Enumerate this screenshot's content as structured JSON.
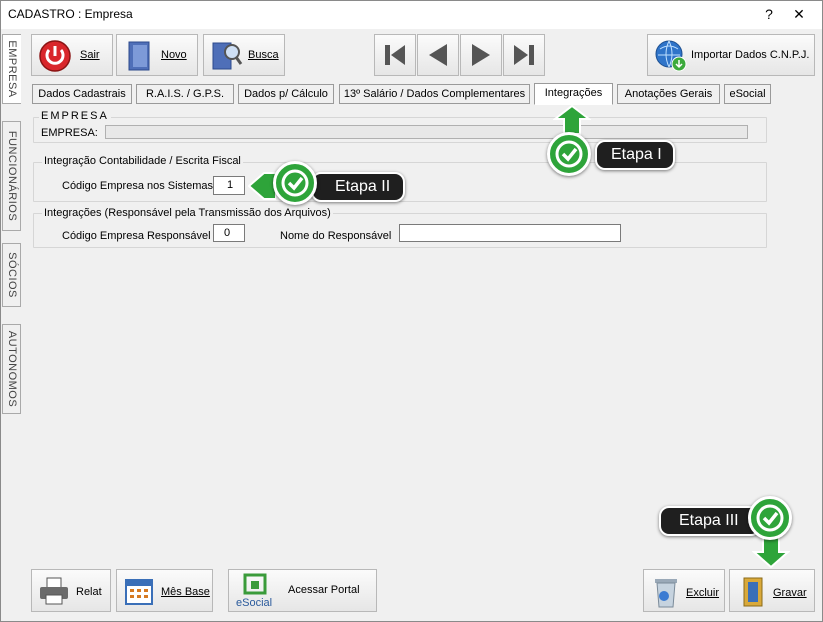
{
  "window": {
    "title": "CADASTRO : Empresa",
    "help": "?",
    "close": "✕"
  },
  "side_tabs": [
    "EMPRESA",
    "FUNCIONÁRIOS",
    "SÓCIOS",
    "AUTONOMOS"
  ],
  "toolbar": {
    "sair": "Sair",
    "novo": "Novo",
    "busca": "Busca",
    "importar": "Importar Dados C.N.P.J."
  },
  "tabs": [
    "Dados Cadastrais",
    "R.A.I.S. / G.P.S.",
    "Dados p/ Cálculo",
    "13º Salário / Dados Complementares",
    "Integrações",
    "Anotações Gerais",
    "eSocial"
  ],
  "empresa_group": {
    "title": "EMPRESA",
    "label": "EMPRESA:",
    "value": ""
  },
  "contab_group": {
    "title": "Integração Contabilidade / Escrita Fiscal",
    "codigo_label": "Código Empresa nos Sistemas",
    "codigo_value": "1"
  },
  "resp_group": {
    "title": "Integrações (Responsável pela Transmissão dos Arquivos)",
    "codigo_label": "Código Empresa Responsável",
    "codigo_value": "0",
    "nome_label": "Nome do Responsável",
    "nome_value": ""
  },
  "bottom": {
    "relat": "Relat",
    "mes_base": "Mês Base",
    "esocial_logo": "eSocial",
    "acessar_portal": "Acessar Portal",
    "excluir": "Excluir",
    "gravar": "Gravar"
  },
  "callouts": {
    "etapa1": "Etapa I",
    "etapa2": "Etapa II",
    "etapa3": "Etapa III"
  },
  "colors": {
    "accent_green": "#2ea43a",
    "callout_bg": "#1f1f1f"
  }
}
